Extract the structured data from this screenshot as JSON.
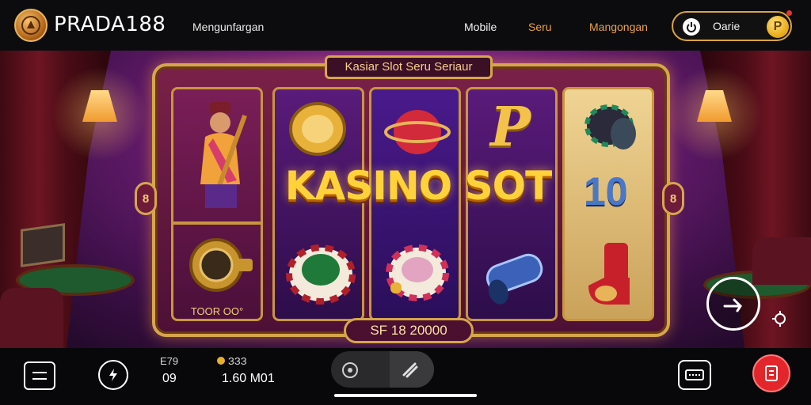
{
  "header": {
    "brand": "PRADA188",
    "subtitle": "Mengunfargan",
    "nav": [
      {
        "label": "Mobile"
      },
      {
        "label": "Seru"
      },
      {
        "label": "Mangongan"
      }
    ],
    "login_label": "Oarie",
    "coin_letter": "P"
  },
  "game": {
    "machine_title": "Kasiar Slot Seru Seriaur",
    "big_title": "KASINO SOT",
    "reel1_caption": "TOOR OO°",
    "win_amount": "SF 18 20000",
    "side_knob_glyph": "8",
    "reel4_letter": "P",
    "reel5_chip_number": "10"
  },
  "bottom": {
    "stat1_label": "E79",
    "stat1_value": "09",
    "stat2_label": "ЗЗЗ",
    "stat2_value": "1.60 M01"
  },
  "colors": {
    "gold": "#d6a64c",
    "accent_orange": "#e9a24a",
    "title_yellow": "#ffd23a",
    "red_button": "#e3262c",
    "bg_purple": "#6c1d73"
  }
}
